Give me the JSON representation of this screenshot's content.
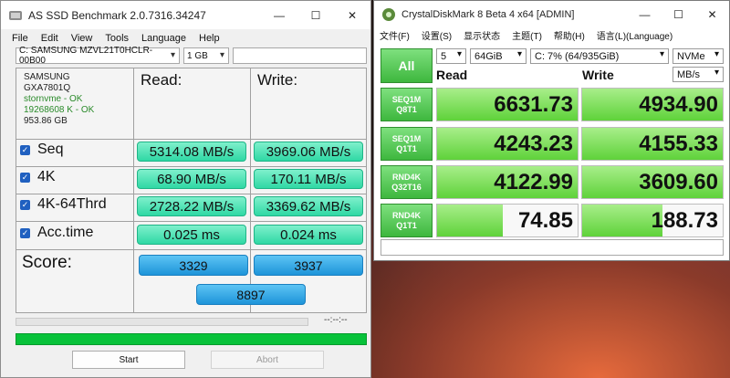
{
  "asssd": {
    "title": "AS SSD Benchmark 2.0.7316.34247",
    "menu": [
      "File",
      "Edit",
      "View",
      "Tools",
      "Language",
      "Help"
    ],
    "drive_select": "C: SAMSUNG MZVL21T0HCLR-00B00",
    "size_select": "1 GB",
    "info": {
      "brand": "SAMSUNG",
      "model": "GXA7801Q",
      "driver": "stornvme - OK",
      "align": "19268608 K - OK",
      "size": "953.86 GB"
    },
    "read_header": "Read:",
    "write_header": "Write:",
    "rows": [
      {
        "label": "Seq",
        "read": "5314.08 MB/s",
        "write": "3969.06 MB/s"
      },
      {
        "label": "4K",
        "read": "68.90 MB/s",
        "write": "170.11 MB/s"
      },
      {
        "label": "4K-64Thrd",
        "read": "2728.22 MB/s",
        "write": "3369.62 MB/s"
      },
      {
        "label": "Acc.time",
        "read": "0.025 ms",
        "write": "0.024 ms"
      }
    ],
    "score_label": "Score:",
    "score_read": "3329",
    "score_write": "3937",
    "score_total": "8897",
    "eta": "--:--:--",
    "start": "Start",
    "abort": "Abort"
  },
  "cdm": {
    "title": "CrystalDiskMark 8 Beta 4 x64 [ADMIN]",
    "menu": [
      "文件(F)",
      "设置(S)",
      "显示状态",
      "主题(T)",
      "帮助(H)",
      "语言(L)(Language)"
    ],
    "all_label": "All",
    "count": "5",
    "size": "64GiB",
    "drive": "C: 7% (64/935GiB)",
    "mode": "NVMe",
    "unit": "MB/s",
    "read_header": "Read",
    "write_header": "Write",
    "rows": [
      {
        "l1": "SEQ1M",
        "l2": "Q8T1",
        "read": "6631.73",
        "write": "4934.90",
        "rfill": 1.0,
        "wfill": 1.0
      },
      {
        "l1": "SEQ1M",
        "l2": "Q1T1",
        "read": "4243.23",
        "write": "4155.33",
        "rfill": 1.0,
        "wfill": 1.0
      },
      {
        "l1": "RND4K",
        "l2": "Q32T16",
        "read": "4122.99",
        "write": "3609.60",
        "rfill": 1.0,
        "wfill": 1.0
      },
      {
        "l1": "RND4K",
        "l2": "Q1T1",
        "read": "74.85",
        "write": "188.73",
        "rfill": 0.47,
        "wfill": 0.57
      }
    ]
  },
  "colors": {
    "cdm_green": "#5fd23a",
    "asssd_pill": "#2fd8a4",
    "asssd_score": "#1d94d9",
    "progress": "#08c23a"
  }
}
